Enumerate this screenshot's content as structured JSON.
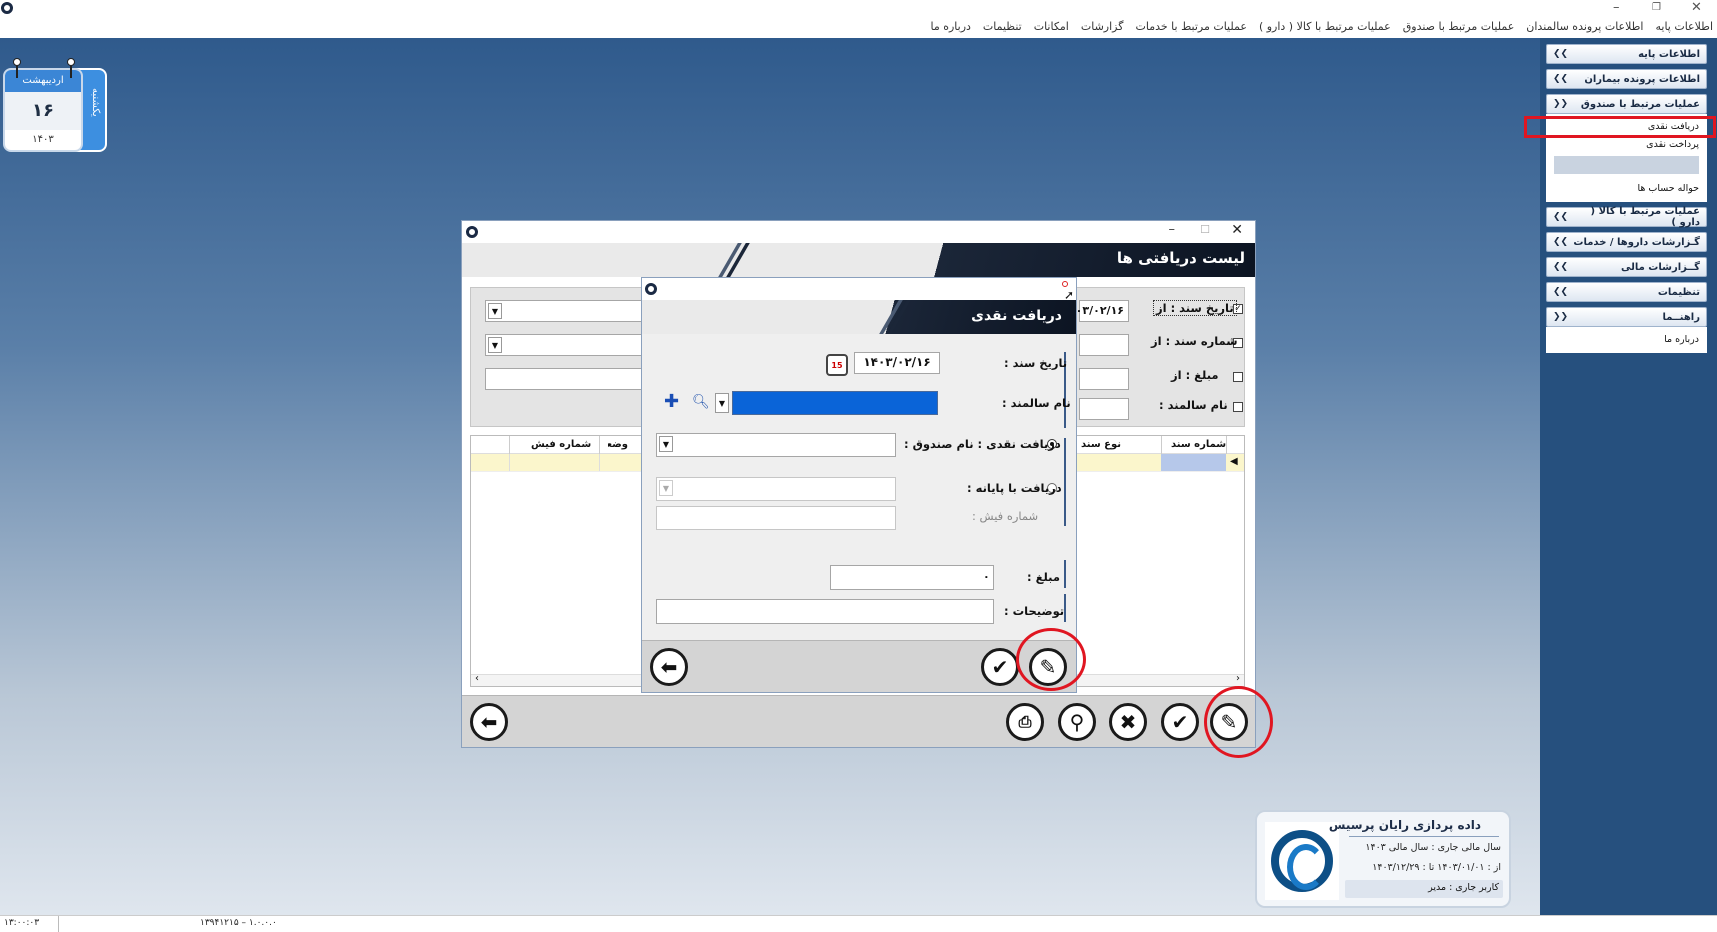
{
  "window": {
    "controls": {
      "minimize": "–",
      "restore": "❐",
      "close": "✕"
    }
  },
  "menu": {
    "items": [
      "اطلاعات پایه",
      "اطلاعات پرونده سالمندان",
      "عملیات مرتبط با صندوق",
      "عملیات مرتبط با کالا ( دارو )",
      "عملیات مرتبط با خدمات",
      "گزارشات",
      "امکانات",
      "تنظیمات",
      "درباره ما"
    ]
  },
  "sidebar": {
    "headers": [
      {
        "label": "اطلاعات پایه",
        "chevron": "expand"
      },
      {
        "label": "اطلاعات پرونده بیماران",
        "chevron": "expand"
      },
      {
        "label": "عملیات مرتبط با صندوق",
        "chevron": "collapse"
      },
      {
        "label": "عملیات مرتبط با کالا ( دارو )",
        "chevron": "expand"
      },
      {
        "label": "گـزارشات داروها / خدمات",
        "chevron": "expand"
      },
      {
        "label": "گــزارشات مالی",
        "chevron": "expand"
      },
      {
        "label": "تنظیمات",
        "chevron": "expand"
      },
      {
        "label": "راهنــما",
        "chevron": "collapse"
      }
    ],
    "fund_items": [
      "دریافت نقدی",
      "پرداخت نقدی",
      "حواله حساب ها"
    ],
    "help_items": [
      "درباره ما"
    ]
  },
  "calendar": {
    "month": "اردیبهشت",
    "day": "۱۶",
    "year": "۱۴۰۳",
    "weekday": "یکشنبه"
  },
  "main_window": {
    "title": "لیست دریافتی ها",
    "filters": {
      "date_from_label": "تاریخ سند : از",
      "date_from_value": "۱۴۰۳/۰۲/۱۶",
      "doc_no_label": "شماره سند : از",
      "amount_label": "مبلغ : از",
      "elder_name_label": "نام سالمند :"
    },
    "columns": [
      "شماره سند",
      "نوع سند",
      "وضعیت",
      "شماره فیش"
    ]
  },
  "dialog": {
    "title": "دریافت نقدی",
    "doc_date_label": "تاریخ سند :",
    "doc_date_value": "۱۴۰۳/۰۲/۱۶",
    "calendar_icon_day": "15",
    "elder_name_label": "نام سالمند :",
    "cash_box_label": "دریافت نقدی : نام صندوق :",
    "terminal_label": "دریافت با پایانه :",
    "receipt_no_label": "شماره فیش :",
    "amount_label": "مبلغ :",
    "amount_value": "۰",
    "description_label": "توضیحات :"
  },
  "company": {
    "name": "داده پردازی رایان پرسیس",
    "fiscal_year": "سال مالی جاری :  سال مالی ۱۴۰۳",
    "range": "از : ۱۴۰۳/۰۱/۰۱   تا : ۱۴۰۳/۱۲/۲۹",
    "user": "کاربر جاری :      مدیر"
  },
  "status": {
    "time": "۱۳:۰۰:۰۳",
    "version": "۱۳۹۴۱۲۱۵ – ۱.۰.۰.۰"
  },
  "colors": {
    "highlight_selection": "#0a64d8",
    "annotation_red": "#e01621",
    "header_dark": "#1b2638"
  }
}
